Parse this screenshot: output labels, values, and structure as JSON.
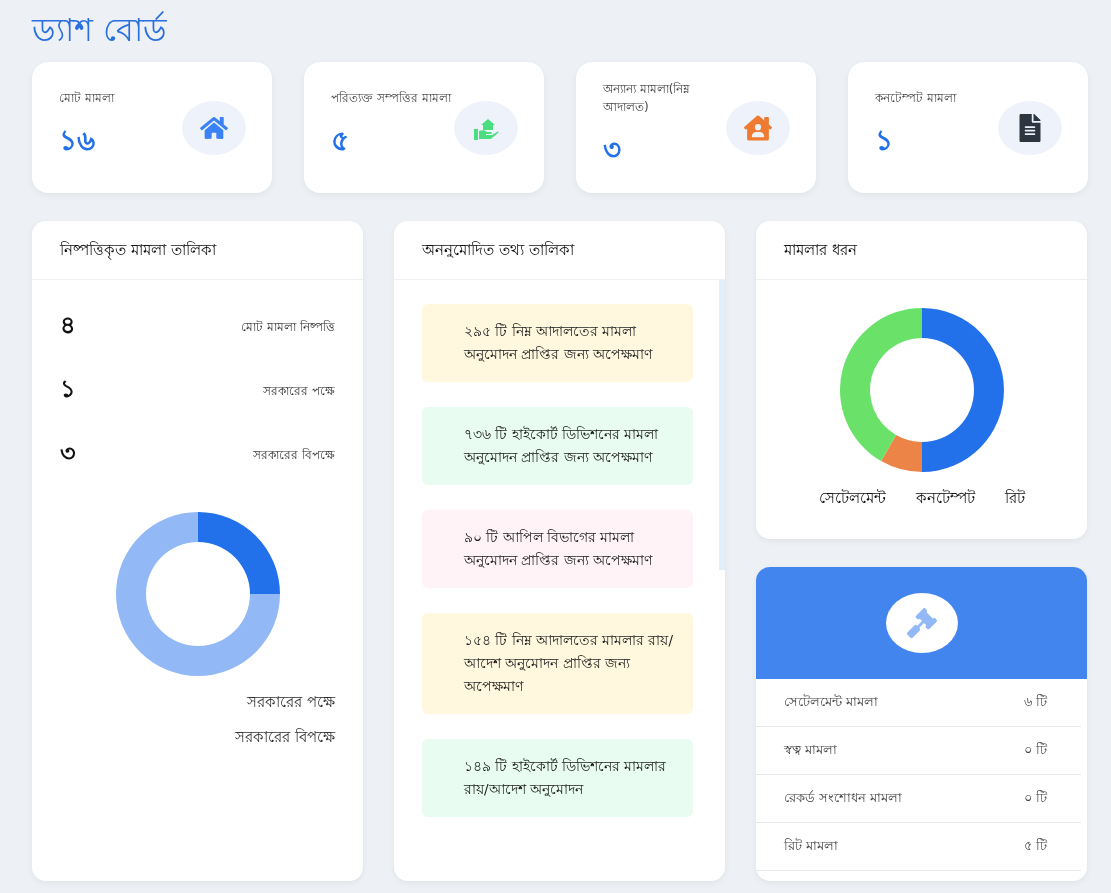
{
  "title": "ড্যাশ বোর্ড",
  "stats": [
    {
      "label": "মোট মামলা",
      "value": "১৬"
    },
    {
      "label": "পরিত্যক্ত সম্পত্তির মামলা",
      "value": "৫"
    },
    {
      "label": "অন্যান্য মামলা(নিম্ন আদালত)",
      "value": "৩"
    },
    {
      "label": "কনটেম্পট মামলা",
      "value": "১"
    }
  ],
  "disposed": {
    "title": "নিষ্পত্তিকৃত মামলা তালিকা",
    "rows": [
      {
        "value": "৪",
        "label": "মোট মামলা নিষ্পত্তি"
      },
      {
        "value": "১",
        "label": "সরকারের পক্ষে"
      },
      {
        "value": "৩",
        "label": "সরকারের বিপক্ষে"
      }
    ],
    "chart_data": {
      "type": "donut",
      "categories": [
        "সরকারের পক্ষে",
        "সরকারের বিপক্ষে"
      ],
      "values": [
        25,
        75
      ],
      "colors": [
        "#2270ea",
        "#93b8f6"
      ]
    }
  },
  "pending": {
    "title": "অননুমোদিত তথ্য তালিকা",
    "items": [
      {
        "text": "২৯৫ টি নিম্ন আদালতের মামলা অনুমোদন প্রাপ্তির জন্য অপেক্ষমাণ",
        "color": "#fff7de"
      },
      {
        "text": "৭৩৬ টি হাইকোর্ট ডিভিশনের মামলা অনুমোদন প্রাপ্তির জন্য অপেক্ষমাণ",
        "color": "#e8fcf1"
      },
      {
        "text": "৯০ টি আপিল বিভাগের মামলা অনুমোদন প্রাপ্তির জন্য অপেক্ষমাণ",
        "color": "#fff3f7"
      },
      {
        "text": "১৫৪ টি নিম্ন আদালতের মামলার রায়/আদেশ অনুমোদন প্রাপ্তির জন্য অপেক্ষমাণ",
        "color": "#fff7de"
      },
      {
        "text": "১৪৯ টি হাইকোর্ট ডিভিশনের মামলার রায়/আদেশ অনুমোদন",
        "color": "#e8fcf1"
      }
    ]
  },
  "types": {
    "title": "মামলার ধরন",
    "chart_data": {
      "type": "donut",
      "categories": [
        "সেটেলমেন্ট",
        "কনটেম্পট",
        "রিট"
      ],
      "values": [
        50,
        8.3,
        41.7
      ],
      "colors": [
        "#2270ea",
        "#ec8447",
        "#6ae26a"
      ]
    }
  },
  "summary": {
    "rows": [
      {
        "label": "সেটেলমেন্ট মামলা",
        "value": "৬ টি"
      },
      {
        "label": "স্বত্ব মামলা",
        "value": "০ টি"
      },
      {
        "label": "রেকর্ড সংশোধন মামলা",
        "value": "০ টি"
      },
      {
        "label": "রিট মামলা",
        "value": "৫ টি"
      }
    ]
  }
}
